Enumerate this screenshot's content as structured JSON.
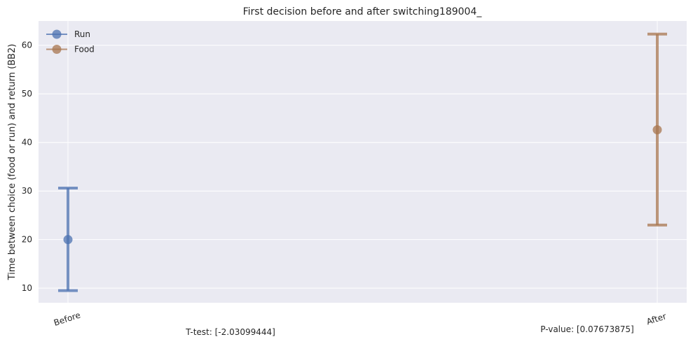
{
  "chart_data": {
    "type": "scatter",
    "title": "First decision before and after switching189004_",
    "xlabel": "",
    "ylabel": "Time between choice (food or run) and return (BB2)",
    "categories": [
      "Before",
      "After"
    ],
    "ylim": [
      7,
      65
    ],
    "yticks": [
      10,
      20,
      30,
      40,
      50,
      60
    ],
    "grid": true,
    "legend_position": "upper-left",
    "series": [
      {
        "name": "Run",
        "color": "#4c72b0",
        "x": "Before",
        "mean": 20.0,
        "err_low": 9.5,
        "err_high": 30.6
      },
      {
        "name": "Food",
        "color": "#a8764f",
        "x": "After",
        "mean": 42.6,
        "err_low": 23.0,
        "err_high": 62.3
      }
    ],
    "annotations": {
      "ttest": "T-test: [-2.03099444]",
      "pvalue": "P-value: [0.07673875]"
    }
  }
}
